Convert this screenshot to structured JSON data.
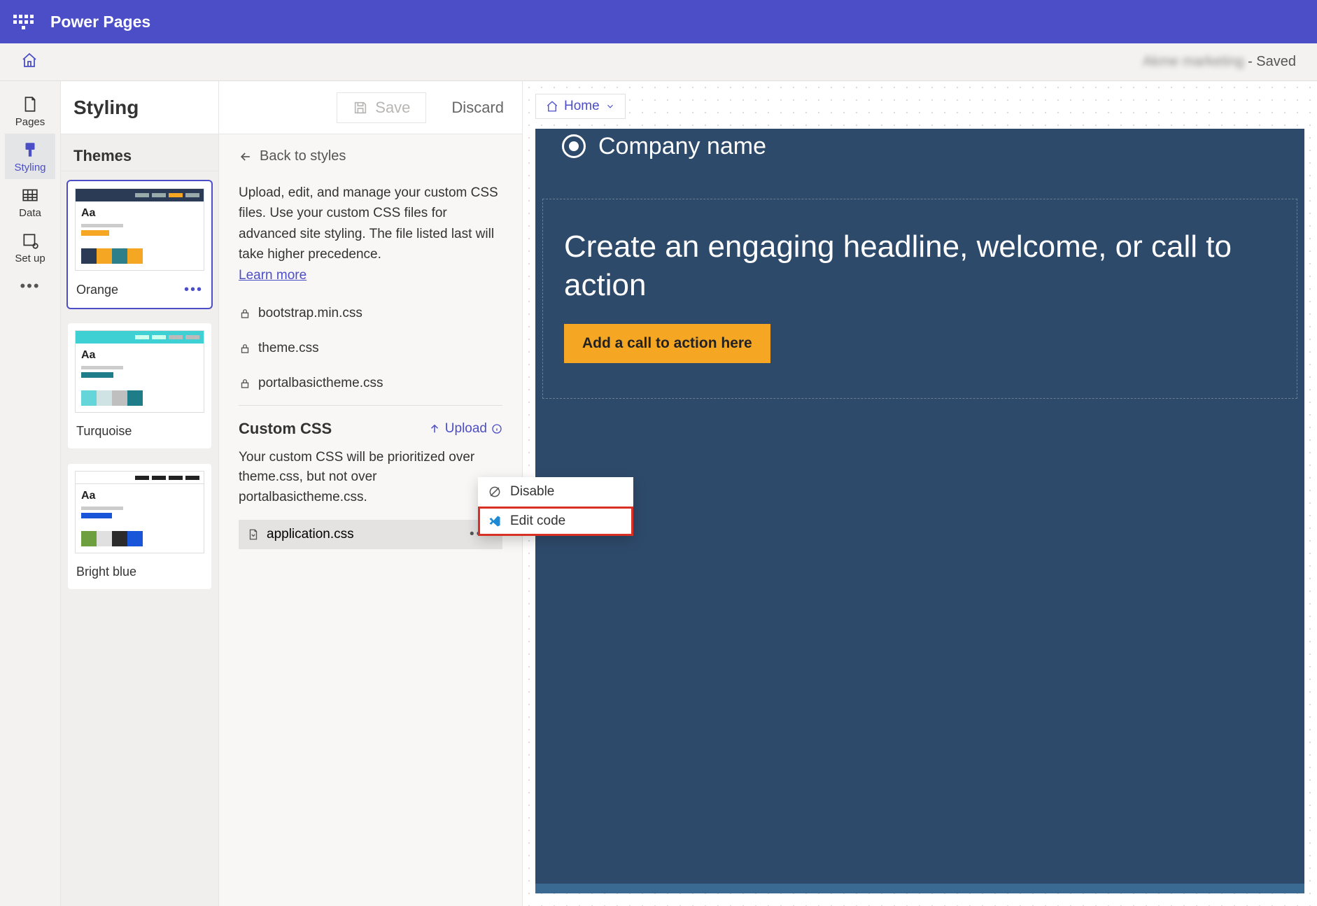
{
  "app_title": "Power Pages",
  "site_status": {
    "name": "Akme marketing",
    "suffix": " - Saved"
  },
  "rail": {
    "items": [
      {
        "id": "pages",
        "label": "Pages"
      },
      {
        "id": "styling",
        "label": "Styling"
      },
      {
        "id": "data",
        "label": "Data"
      },
      {
        "id": "setup",
        "label": "Set up"
      }
    ]
  },
  "styling": {
    "title": "Styling",
    "save": "Save",
    "discard": "Discard",
    "themes_heading": "Themes",
    "themes": [
      {
        "id": "orange",
        "label": "Orange",
        "head": "#2b3a55",
        "accent": "#f5a623",
        "sw": [
          "#2b3a55",
          "#f5a623",
          "#2d7f8a",
          "#f5a623"
        ]
      },
      {
        "id": "turquoise",
        "label": "Turquoise",
        "head": "#3fd0d4",
        "accent": "#1f7d89",
        "sw": [
          "#64d6da",
          "#cfe3e5",
          "#bfbfbf",
          "#1f7d89"
        ]
      },
      {
        "id": "brightblue",
        "label": "Bright blue",
        "head": "#222222",
        "accent": "#1855d9",
        "sw": [
          "#6d9f3e",
          "#e0e0e0",
          "#2b2b2b",
          "#1855d9"
        ]
      }
    ]
  },
  "css_panel": {
    "back": "Back to styles",
    "desc": "Upload, edit, and manage your custom CSS files. Use your custom CSS files for advanced site styling. The file listed last will take higher precedence.",
    "learn_more": "Learn more",
    "files": [
      "bootstrap.min.css",
      "theme.css",
      "portalbasictheme.css"
    ],
    "custom_heading": "Custom CSS",
    "upload_label": "Upload",
    "custom_desc": "Your custom CSS will be prioritized over theme.css, but not over portalbasictheme.css.",
    "custom_file": "application.css",
    "menu": {
      "disable": "Disable",
      "edit_code": "Edit code"
    }
  },
  "preview": {
    "crumb": "Home",
    "company": "Company name",
    "headline": "Create an engaging headline, welcome, or call to action",
    "cta": "Add a call to action here"
  }
}
